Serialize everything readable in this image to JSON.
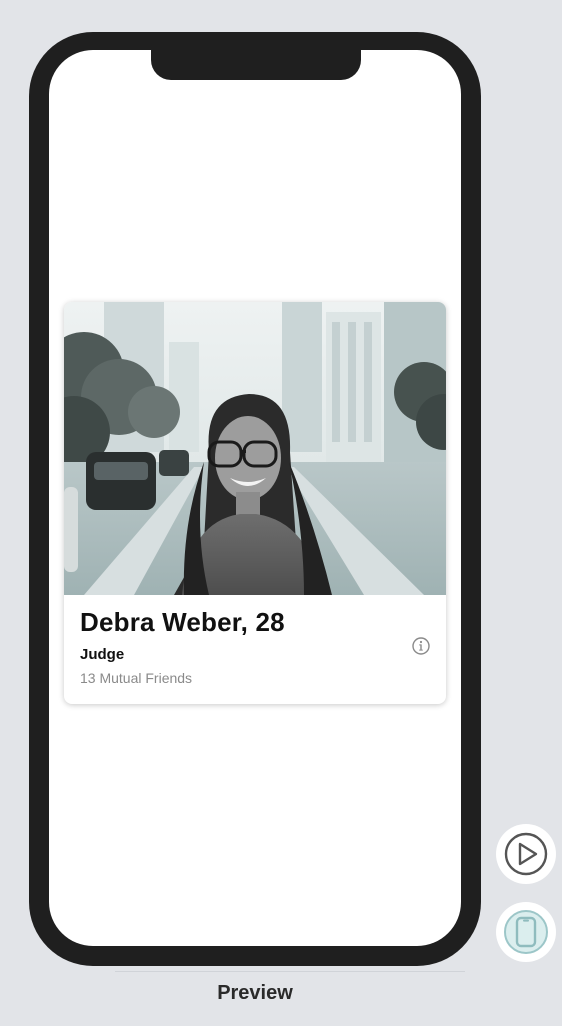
{
  "profile": {
    "name_age": "Debra Weber, 28",
    "occupation": "Judge",
    "mutual_friends": "13 Mutual Friends"
  },
  "preview": {
    "label": "Preview"
  },
  "icons": {
    "info": "info-icon",
    "play": "play-icon",
    "device": "device-icon"
  },
  "colors": {
    "frame": "#1f1f1f",
    "background": "#e2e4e8",
    "photo_tint": "#8fa6aa"
  }
}
